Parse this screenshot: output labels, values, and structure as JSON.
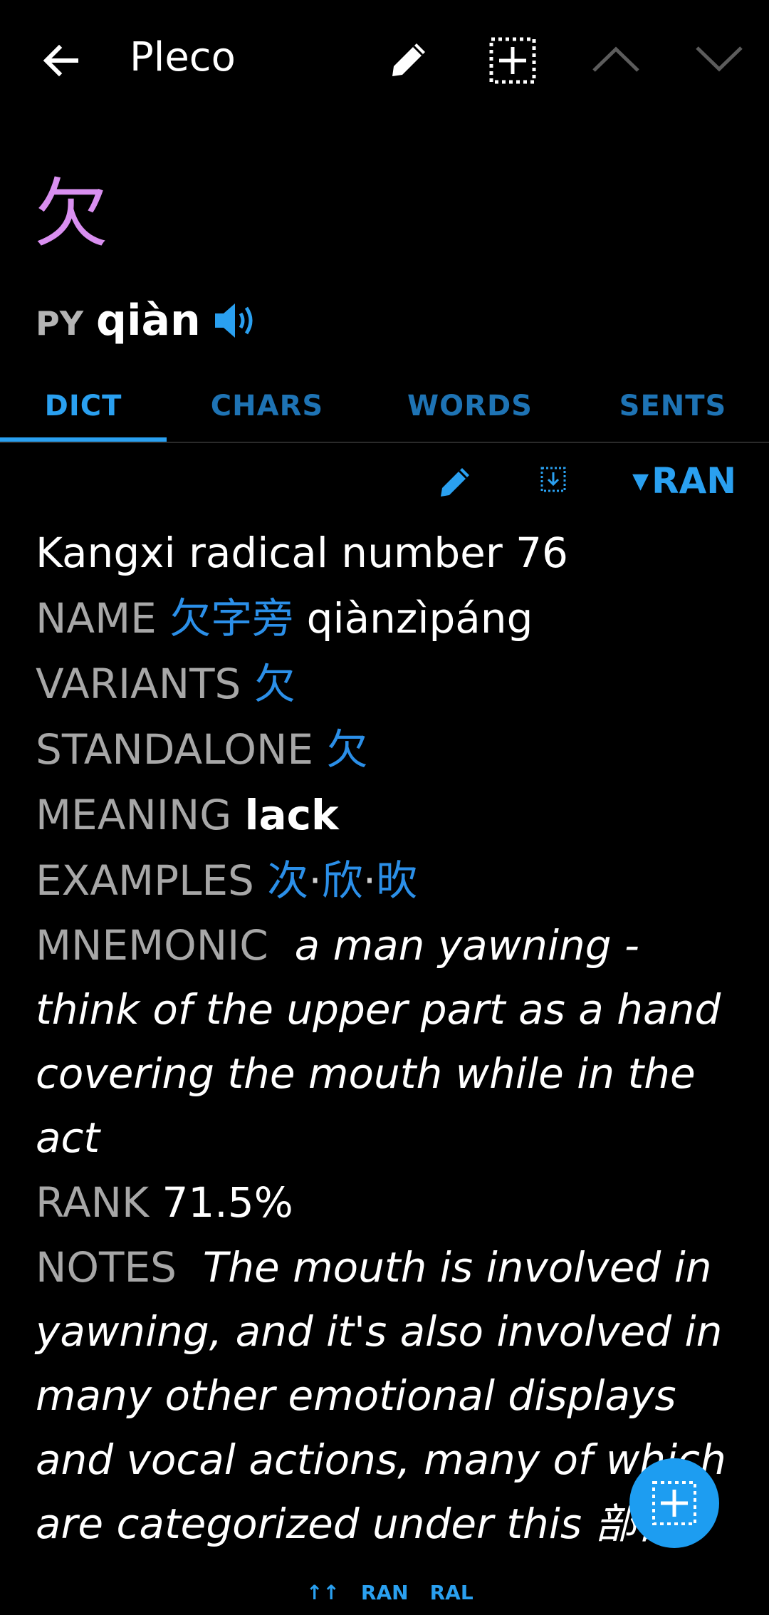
{
  "topbar": {
    "title": "Pleco",
    "icons": [
      "back-arrow-icon",
      "pencil-icon",
      "crosshair-grid-icon",
      "chevron-up-icon",
      "chevron-down-icon"
    ]
  },
  "headword": {
    "character": "欠",
    "py_label": "PY",
    "pinyin": "qiàn",
    "audio_icon": "speaker-icon"
  },
  "tabs": [
    {
      "label": "DICT",
      "active": true
    },
    {
      "label": "CHARS",
      "active": false
    },
    {
      "label": "WORDS",
      "active": false
    },
    {
      "label": "SENTS",
      "active": false
    }
  ],
  "dict_toolbar": {
    "dictionary": "RAN",
    "icons": [
      "pencil-icon",
      "save-download-icon",
      "dropdown-triangle-icon"
    ]
  },
  "entry": {
    "definition": "Kangxi radical number 76",
    "name_label": "NAME",
    "name_cn": "欠字旁",
    "name_py": "qiànzìpáng",
    "variants_label": "VARIANTS",
    "variants_value": "欠",
    "standalone_label": "STANDALONE",
    "standalone_value": "欠",
    "meaning_label": "MEANING",
    "meaning_value": "lack",
    "examples_label": "EXAMPLES",
    "examples": [
      "次",
      "欣",
      "欥"
    ],
    "examples_sep": "·",
    "mnemonic_label": "MNEMONIC",
    "mnemonic_text": "a man yawning - think of the upper part as a hand covering the mouth while in the act",
    "rank_label": "RANK",
    "rank_value": "71.5%",
    "notes_label": "NOTES",
    "notes_text": "The mouth is involved in yawning, and it's also involved in many other emotional displays and vocal actions, many of which are categorized under this 部首"
  },
  "fab": {
    "icon": "add-crosshair-icon"
  },
  "bottom_nav": {
    "up_icon": "↑↑",
    "item1": "RAN",
    "item2": "RAL"
  },
  "colors": {
    "background": "#000000",
    "accent": "#2aa0f0",
    "chinese_link": "#2b8fe8",
    "headword": "#d98ff0",
    "label_gray": "#a7a7a7"
  }
}
